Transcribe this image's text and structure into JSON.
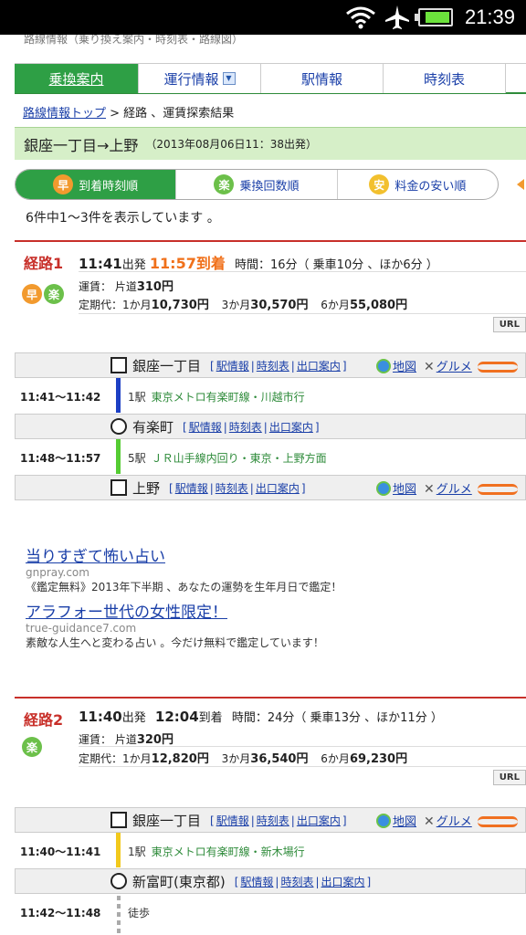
{
  "status_bar": {
    "time": "21:39"
  },
  "top_cut_text": "路線情報（乗り換え案内・時刻表・路線図）",
  "tabs": [
    {
      "label": "乗換案内",
      "active": true
    },
    {
      "label": "運行情報",
      "active": false
    },
    {
      "label": "駅情報",
      "active": false
    },
    {
      "label": "時刻表",
      "active": false
    }
  ],
  "breadcrumb": {
    "link": "路線情報トップ",
    "rest": " > 経路 、運賃探索結果"
  },
  "route_header": {
    "title": "銀座一丁目→上野",
    "sub": "（2013年08月06日11：38出発）"
  },
  "sort_options": [
    {
      "badge": "早",
      "label": "到着時刻順",
      "active": true
    },
    {
      "badge": "楽",
      "label": "乗換回数順",
      "active": false
    },
    {
      "badge": "安",
      "label": "料金の安い順",
      "active": false
    }
  ],
  "result_count": "6件中1～3件を表示しています 。",
  "routes": [
    {
      "label": "経路1",
      "depart": "11:41",
      "depart_suffix": "出発",
      "arrive": "11:57",
      "arrive_suffix": "到着",
      "time_info": "時間：16分（ 乗車10分 、ほか6分 ）",
      "fare_label": "運賃： 片道",
      "fare": "310円",
      "pass_label": "定期代：",
      "pass_1m_label": "1か月",
      "pass_1m": "10,730円",
      "pass_3m_label": "3か月",
      "pass_3m": "30,570円",
      "pass_6m_label": "6か月",
      "pass_6m": "55,080円",
      "badges": [
        "早",
        "楽"
      ],
      "url_label": "URL"
    },
    {
      "label": "経路2",
      "depart": "11:40",
      "depart_suffix": "出発",
      "arrive": "12:04",
      "arrive_suffix": "到着",
      "time_info": "時間：24分（ 乗車13分 、ほか11分 ）",
      "fare_label": "運賃： 片道",
      "fare": "320円",
      "pass_label": "定期代：",
      "pass_1m_label": "1か月",
      "pass_1m": "12,820円",
      "pass_3m_label": "3か月",
      "pass_3m": "36,540円",
      "pass_6m_label": "6か月",
      "pass_6m": "69,230円",
      "badges": [
        "楽"
      ],
      "url_label": "URL"
    }
  ],
  "station_links": {
    "info": "駅情報",
    "timetable": "時刻表",
    "exit": "出口案内",
    "map": "地図",
    "gourmet": "グルメ"
  },
  "route1_stations": [
    {
      "name": "銀座一丁目",
      "shape": "square"
    },
    {
      "name": "有楽町",
      "shape": "circle"
    },
    {
      "name": "上野",
      "shape": "square"
    }
  ],
  "route1_segments": [
    {
      "time": "11:41～11:42",
      "stops": "1駅",
      "line": "東京メトロ有楽町線・川越市行",
      "color": "#1c3fc4"
    },
    {
      "time": "11:48～11:57",
      "stops": "5駅",
      "line": "ＪＲ山手線内回り・東京・上野方面",
      "color": "#55cc33"
    }
  ],
  "route2_stations": [
    {
      "name": "銀座一丁目",
      "shape": "square"
    },
    {
      "name": "新富町(東京都)",
      "shape": "circle"
    }
  ],
  "route2_segments": [
    {
      "time": "11:40～11:41",
      "stops": "1駅",
      "line": "東京メトロ有楽町線・新木場行",
      "color": "#f2c91c"
    },
    {
      "time": "11:42～11:48",
      "stops": "徒歩",
      "line": "",
      "color": "#aaaaaa"
    }
  ],
  "ads": [
    {
      "title": "当りすぎて怖い占い",
      "url": "gnpray.com",
      "desc": "《鑑定無料》2013年下半期 、あなたの運勢を生年月日で鑑定！"
    },
    {
      "title": "アラフォー世代の女性限定！",
      "url": "true-guidance7.com",
      "desc": "素敵な人生へと変わる占い 。今だけ無料で鑑定しています！"
    }
  ]
}
